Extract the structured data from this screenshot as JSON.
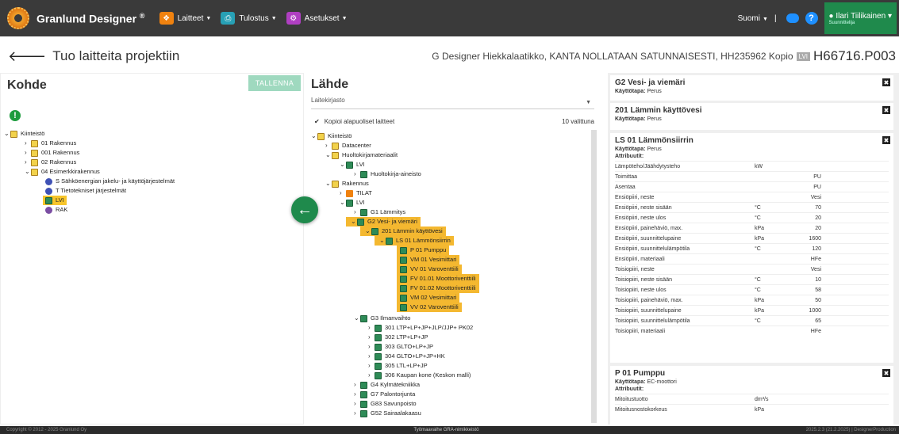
{
  "app": {
    "name": "Granlund Designer",
    "reg": "®"
  },
  "nav": {
    "items": [
      {
        "label": "Laitteet",
        "color": "#f0820f"
      },
      {
        "label": "Tulostus",
        "color": "#27a0b5"
      },
      {
        "label": "Asetukset",
        "color": "#b03fc2"
      }
    ],
    "lang": "Suomi",
    "sep": "|",
    "user": "Ilari Tiilikainen",
    "role": "Suunnittelija"
  },
  "page": {
    "title": "Tuo laitteita projektiin",
    "info": "G Designer Hiekkalaatikko, KANTA NOLLATAAN SATUNNAISESTI, HH235962 Kopio",
    "badge": "LVI",
    "code": "H66716.P003"
  },
  "left": {
    "title": "Kohde",
    "save": "TALLENNA",
    "warn": "!",
    "tree": [
      "Kiinteistö",
      "01 Rakennus",
      "001 Rakennus",
      "02 Rakennus",
      "04 Esimerkkirakennus",
      "S Sähköenergian jakelu- ja käyttöjärjestelmät",
      "T Tietotekniset järjestelmät",
      "LVI",
      "RAK"
    ]
  },
  "middle": {
    "title": "Lähde",
    "dropdown": "Laitekirjasto",
    "copy": "Kopioi alapuoliset laitteet",
    "count": "10 valittuna",
    "tree": [
      "Kiinteistö",
      "Datacenter",
      "Huoltokirjamateriaalit",
      "LVI",
      "Huoltokirja-aineisto",
      "Rakennus",
      "TILAT",
      "LVI",
      "G1 Lämmitys",
      "G2 Vesi- ja viemäri",
      "201 Lämmin käyttövesi",
      "LS 01 Lämmönsiirrin",
      "P 01 Pumppu",
      "VM 01 Vesimittari",
      "VV 01 Varoventtiili",
      "FV 01.01 Moottoriventtiili",
      "FV 01.02 Moottoriventtiili",
      "VM 02 Vesimittari",
      "VV 02 Varoventtiili",
      "G3 Ilmanvaihto",
      "301 LTP+LP+JP+JLP/JJP+ PK02",
      "302 LTP+LP+JP",
      "303 GLTO+LP+JP",
      "304 GLTO+LP+JP+HK",
      "305 LTL+LP+JP",
      "306 Kaupan kone (Keskon malli)",
      "G4 Kylmätekniikka",
      "G7 Palontorjunta",
      "G83 Savunpoisto",
      "G52 Sairaalakaasu"
    ]
  },
  "right": {
    "cards": [
      {
        "title": "G2 Vesi- ja viemäri",
        "kt_label": "Käyttötapa:",
        "kt": "Perus"
      },
      {
        "title": "201 Lämmin käyttövesi",
        "kt_label": "Käyttötapa:",
        "kt": "Perus"
      },
      {
        "title": "LS 01 Lämmönsiirrin",
        "kt_label": "Käyttötapa:",
        "kt": "Perus",
        "attr_label": "Attribuutit:",
        "attrs": [
          [
            "Lämpöteho/Jäähdytysteho",
            "kW",
            ""
          ],
          [
            "Toimittaa",
            "",
            "PU"
          ],
          [
            "Asentaa",
            "",
            "PU"
          ],
          [
            "Ensiöpiiri, neste",
            "",
            "Vesi"
          ],
          [
            "Ensiöpiiri, neste sisään",
            "°C",
            "70"
          ],
          [
            "Ensiöpiiri, neste ulos",
            "°C",
            "20"
          ],
          [
            "Ensiöpiiri, painehäviö, max.",
            "kPa",
            "20"
          ],
          [
            "Ensiöpiiri, suunnittelupaine",
            "kPa",
            "1600"
          ],
          [
            "Ensiöpiiri, suunnittelulämpötila",
            "°C",
            "120"
          ],
          [
            "Ensiöpiiri, materiaali",
            "",
            "HFe"
          ],
          [
            "Toisiopiiri, neste",
            "",
            "Vesi"
          ],
          [
            "Toisiopiiri, neste sisään",
            "°C",
            "10"
          ],
          [
            "Toisiopiiri, neste ulos",
            "°C",
            "58"
          ],
          [
            "Toisiopiiri, painehäviö, max.",
            "kPa",
            "50"
          ],
          [
            "Toisiopiiri, suunnittelupaine",
            "kPa",
            "1000"
          ],
          [
            "Toisiopiiri, suunnittelulämpötila",
            "°C",
            "65"
          ],
          [
            "Toisiopiiri, materiaali",
            "",
            "HFe"
          ]
        ]
      },
      {
        "title": "P 01 Pumppu",
        "kt_label": "Käyttötapa:",
        "kt": "EC-moottori",
        "attr_label": "Attribuutit:",
        "attrs": [
          [
            "Mitoitustuotto",
            "dm³/s",
            ""
          ],
          [
            "Mitoitusnostokorkeus",
            "kPa",
            ""
          ]
        ]
      }
    ]
  },
  "footer": {
    "copy": "Copyright © 2012 - 2025 Granlund Oy",
    "mid": "Työmaavaihe   GRA-nimikkeistö",
    "ver": "2025.2.3 (21.2.2025) | DesignerProduction"
  }
}
